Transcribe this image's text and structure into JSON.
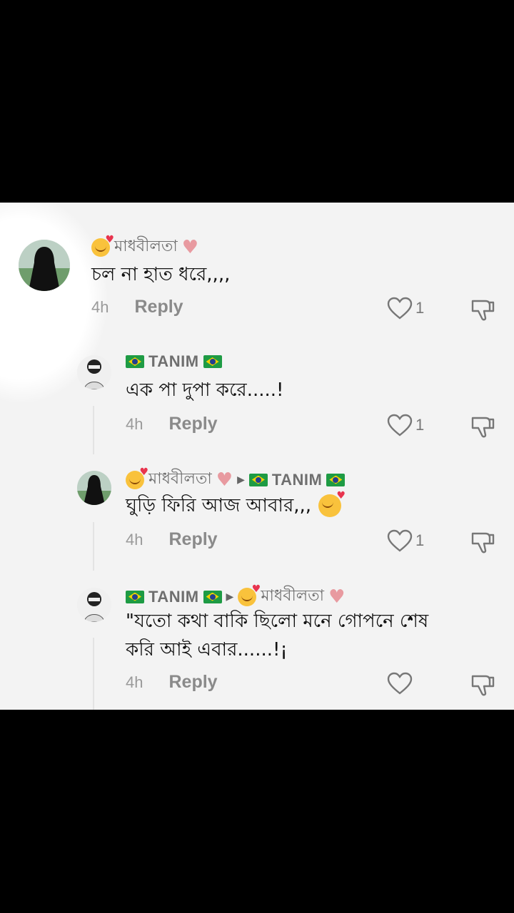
{
  "comments": [
    {
      "user": "মাধবীলতা",
      "text": "চল না হাত ধরে,,,,",
      "time": "4h",
      "reply": "Reply",
      "likes": "1"
    },
    {
      "user": "TANIM",
      "text": "এক পা দুপা করে.....!",
      "time": "4h",
      "reply": "Reply",
      "likes": "1"
    },
    {
      "user": "মাধবীলতা",
      "reply_to": "TANIM",
      "text": "ঘুড়ি ফিরি আজ আবার,,,",
      "time": "4h",
      "reply": "Reply",
      "likes": "1"
    },
    {
      "user": "TANIM",
      "reply_to": "মাধবীলতা",
      "text_line1": "\"যতো কথা বাকি ছিলো মনে গোপনে শেষ",
      "text_line2": "করি আই এবার......!¡",
      "time": "4h",
      "reply": "Reply",
      "likes": ""
    }
  ],
  "icons": {
    "like": "heart-outline-icon",
    "dislike": "thumbs-down-icon",
    "flag": "brazil-flag-icon",
    "emoji": "smiling-face-with-hearts-icon"
  }
}
